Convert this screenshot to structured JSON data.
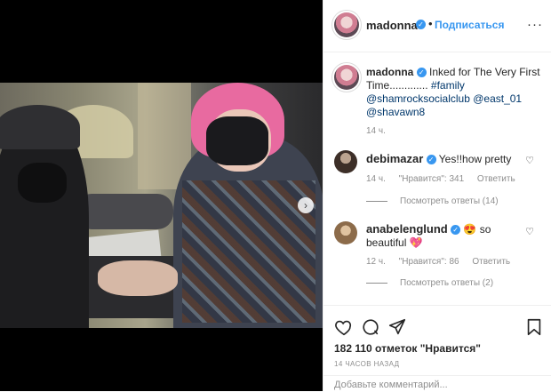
{
  "post": {
    "author": "madonna",
    "follow_label": "Подписаться",
    "dot": "•",
    "more": "···",
    "caption_text": "Inked for The Very First Time.............",
    "caption_hashtag": "#family",
    "caption_mentions": "@shamrocksocialclub @east_01 @shavawn8",
    "caption_time": "14 ч.",
    "likes_text": "182 110 отметок \"Нравится\"",
    "posted_ago": "14 ЧАСОВ НАЗАД",
    "add_comment_placeholder": "Добавьте комментарий..."
  },
  "comments": [
    {
      "author": "debimazar",
      "text": "Yes!!how pretty",
      "time": "14 ч.",
      "likes": "\"Нравится\": 341",
      "reply": "Ответить",
      "replies_label": "Посмотреть ответы (14)"
    },
    {
      "author": "anabelenglund",
      "text": "😍 so beautiful 💖",
      "time": "12 ч.",
      "likes": "\"Нравится\": 86",
      "reply": "Ответить",
      "replies_label": "Посмотреть ответы (2)"
    }
  ],
  "icons": {
    "next": "chevron-right-icon",
    "like": "heart-icon",
    "comment": "comment-icon",
    "share": "paper-plane-icon",
    "save": "bookmark-icon",
    "verified": "verified-badge-icon"
  },
  "colors": {
    "accent": "#3897f0",
    "muted": "#8e8e8e",
    "text": "#262626"
  }
}
